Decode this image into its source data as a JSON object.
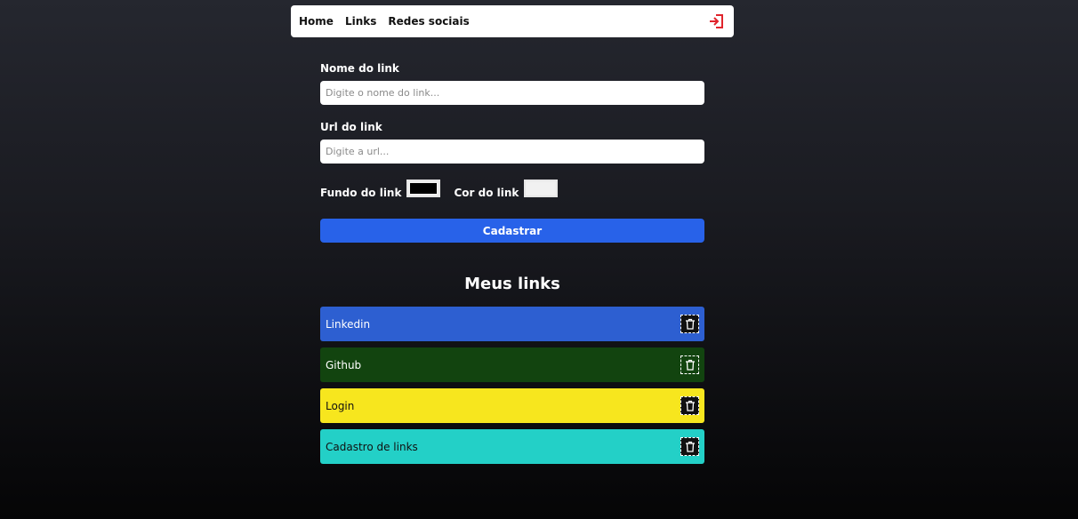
{
  "nav": {
    "links": [
      "Home",
      "Links",
      "Redes sociais"
    ],
    "logout_icon": "logout-icon",
    "logout_color": "#e0242c"
  },
  "form": {
    "name_label": "Nome do link",
    "name_placeholder": "Digite o nome do link...",
    "url_label": "Url do link",
    "url_placeholder": "Digite a url...",
    "bg_label": "Fundo do link",
    "bg_color": "#000000",
    "text_label": "Cor do link",
    "text_color": "#f1f1f1",
    "submit_label": "Cadastrar",
    "submit_color": "#2862e9"
  },
  "links_title": "Meus links",
  "links": [
    {
      "name": "Linkedin",
      "bg": "#2d5fd1",
      "color": "#ffffff",
      "trash_icon": "trash-icon"
    },
    {
      "name": "Github",
      "bg": "#12440f",
      "color": "#ffffff",
      "trash_icon": "trash-icon"
    },
    {
      "name": "Login",
      "bg": "#f7e61e",
      "color": "#111111",
      "trash_icon": "trash-icon"
    },
    {
      "name": "Cadastro de links",
      "bg": "#23d0c7",
      "color": "#111111",
      "trash_icon": "trash-icon"
    }
  ]
}
